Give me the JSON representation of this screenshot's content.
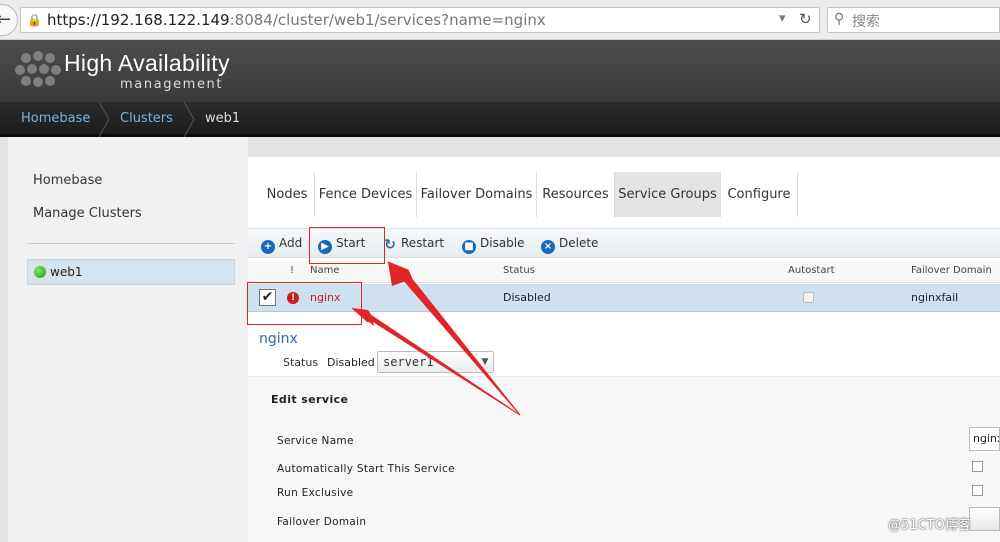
{
  "browser": {
    "url_host": "https://192.168.122.149",
    "url_rest": ":8084/cluster/web1/services?name=nginx",
    "search_placeholder": "搜索"
  },
  "header": {
    "title": "High Availability",
    "subtitle": "management"
  },
  "breadcrumb": [
    "Homebase",
    "Clusters",
    "web1"
  ],
  "left_nav": {
    "items": [
      "Homebase",
      "Manage Clusters"
    ],
    "cluster_node": "web1",
    "node_status_color": "#2db317"
  },
  "tabs": [
    {
      "label": "Nodes",
      "active": false
    },
    {
      "label": "Fence Devices",
      "active": false
    },
    {
      "label": "Failover Domains",
      "active": false
    },
    {
      "label": "Resources",
      "active": false
    },
    {
      "label": "Service Groups",
      "active": true
    },
    {
      "label": "Configure",
      "active": false
    }
  ],
  "toolbar": {
    "add": "Add",
    "start": "Start",
    "restart": "Restart",
    "disable": "Disable",
    "delete": "Delete"
  },
  "grid": {
    "headers": {
      "status_flag": "!",
      "name": "Name",
      "status": "Status",
      "autostart": "Autostart",
      "failover_domain": "Failover Domain"
    },
    "rows": [
      {
        "checked": true,
        "error": true,
        "name": "nginx",
        "status": "Disabled",
        "autostart": false,
        "failover_domain": "nginxfail"
      }
    ]
  },
  "service_detail": {
    "title": "nginx",
    "status_label": "Status",
    "status_value": "Disabled",
    "node_select": "server1",
    "edit_title": "Edit service",
    "fields": {
      "service_name_label": "Service Name",
      "service_name_value": "nginx",
      "autostart_label": "Automatically Start This Service",
      "run_exclusive_label": "Run Exclusive",
      "failover_domain_label": "Failover Domain"
    }
  },
  "watermark": "@51CTO博客",
  "colors": {
    "annotation": "#e02626",
    "link": "#2a6ea8",
    "error": "#d21b1b",
    "selected_row": "#cfe0ee"
  }
}
